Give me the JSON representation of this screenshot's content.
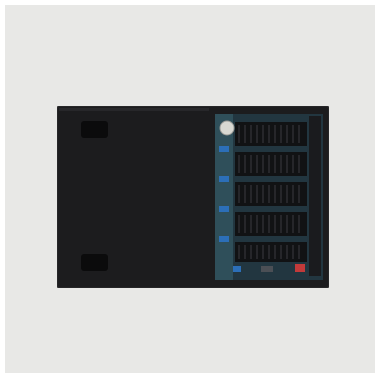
{
  "image": {
    "subject": "black-enclosure-open-side-with-circuit-board-and-heatsink-modules",
    "colors": {
      "background": "#e8e8e6",
      "case": "#1c1c1e",
      "case_edge": "#2a2a2c",
      "board": "#2f4f5a",
      "heatsink": "#111214",
      "component_blue": "#2c6fb8",
      "component_red": "#c23a3a",
      "rubber_foot": "#0b0b0c"
    }
  }
}
